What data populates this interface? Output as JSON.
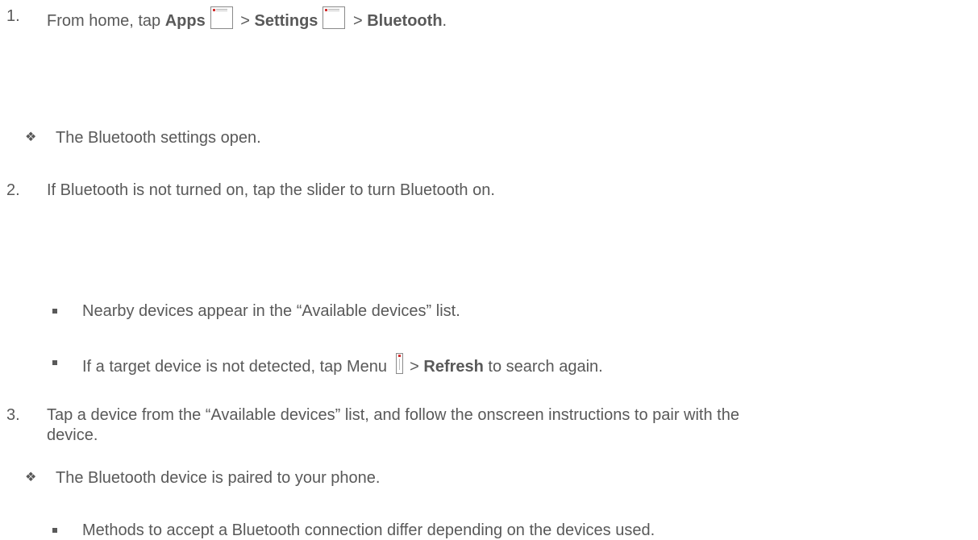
{
  "steps": [
    {
      "number": "1.",
      "parts": {
        "pre": "From home, tap ",
        "apps": "Apps",
        "sep1": " > ",
        "settings": "Settings",
        "sep2": " > ",
        "bluetooth": "Bluetooth",
        "end": "."
      },
      "result": "The Bluetooth settings open."
    },
    {
      "number": "2.",
      "text": "If Bluetooth is not turned on, tap the slider to turn Bluetooth on.",
      "bullets": [
        "Nearby devices appear in the “Available devices” list.",
        {
          "pre": "If a target device is not detected, tap Menu ",
          "sep": " > ",
          "refresh": "Refresh",
          "post": " to search again."
        }
      ]
    },
    {
      "number": "3.",
      "text_line1": "Tap a device from the “Available devices” list, and follow the onscreen instructions to pair with the",
      "text_line2": "device.",
      "result": "The Bluetooth device is paired to your phone.",
      "bullets": [
        "Methods to accept a Bluetooth connection differ depending on the devices used."
      ]
    }
  ],
  "icons": {
    "apps": "apps-icon",
    "settings": "settings-icon",
    "menu": "menu-icon",
    "result_marker": "diamond-bullet-icon",
    "bullet_marker": "square-bullet-icon"
  },
  "colors": {
    "text": "#595959",
    "icon_accent": "#d23030"
  }
}
